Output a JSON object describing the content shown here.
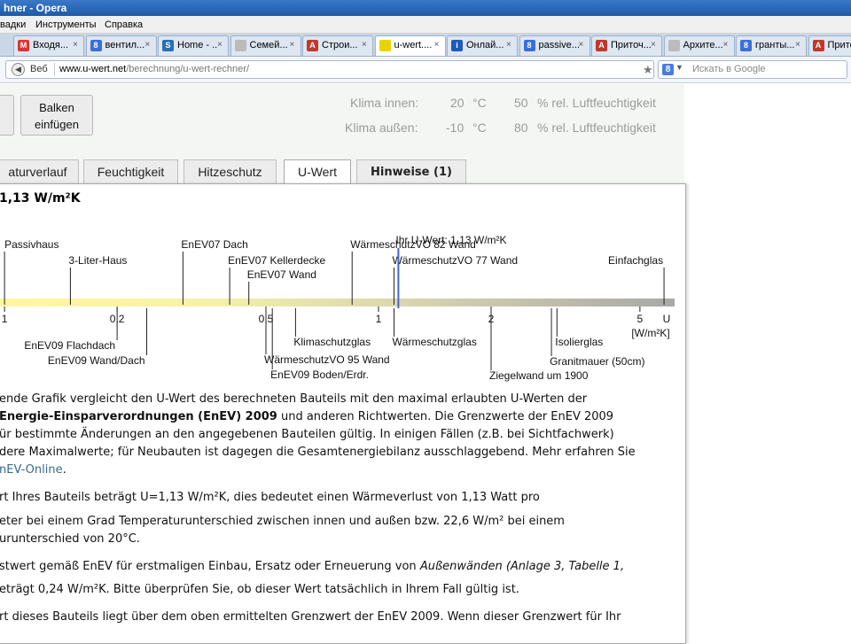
{
  "browser": {
    "title": "hner - Opera",
    "menu": [
      "вадки",
      "Инструменты",
      "Справка"
    ],
    "tabs": [
      {
        "label": "Входя...",
        "fav": "M",
        "color": "#d33"
      },
      {
        "label": "вентил...",
        "fav": "8",
        "color": "#3b6fd6"
      },
      {
        "label": "Home - ...",
        "fav": "S",
        "color": "#2a6fb0"
      },
      {
        "label": "Семей...",
        "fav": "",
        "color": "#bbbbbb"
      },
      {
        "label": "Строи...",
        "fav": "A",
        "color": "#c0392b"
      },
      {
        "label": "u-wert....",
        "fav": "",
        "color": "#e8d400"
      },
      {
        "label": "Онлай...",
        "fav": "i",
        "color": "#1f5ab8"
      },
      {
        "label": "passive...",
        "fav": "8",
        "color": "#3b6fd6"
      },
      {
        "label": "Приточ...",
        "fav": "A",
        "color": "#c0392b"
      },
      {
        "label": "Архите...",
        "fav": "",
        "color": "#bbbbbb"
      },
      {
        "label": "гранты...",
        "fav": "8",
        "color": "#3b6fd6"
      },
      {
        "label": "Приточ...",
        "fav": "A",
        "color": "#c0392b"
      }
    ],
    "active_tab": 5,
    "web_label": "Веб",
    "url_domain": "www.u-wert.net",
    "url_path": "/berechnung/u-wert-rechner/",
    "search_placeholder": "Искать в Google"
  },
  "page": {
    "balken_button": "Balken einfügen",
    "climate": {
      "inside_label": "Klima innen:",
      "inside_temp": "20",
      "inside_humidity": "50",
      "outside_label": "Klima außen:",
      "outside_temp": "-10",
      "outside_humidity": "80",
      "temp_unit": "°C",
      "humidity_unit": "% rel. Luftfeuchtigkeit"
    },
    "tabs": [
      "aturverlauf",
      "Feuchtigkeit",
      "Hitzeschutz",
      "U-Wert",
      "Hinweise (1)"
    ],
    "active_tab": 3,
    "heading": "1,13 W/m²K",
    "paragraphs": {
      "p1_l1": "ende Grafik vergleicht den U-Wert des berechneten Bauteils mit den maximal erlaubten U-Werten der",
      "p1_l2_bold": " Energie-Einsparverordnungen (EnEV) 2009",
      "p1_l2_rest": " und anderen Richtwerten. Die Grenzwerte der EnEV 2009",
      "p1_l3": "ür bestimmte Änderungen an den angegebenen Bauteilen gültig. In einigen Fällen (z.B. bei Sichtfachwerk)",
      "p1_l4": "dere Maximalwerte; für Neubauten ist dagegen die Gesamtenergiebilanz ausschlaggebend. Mehr erfahren Sie",
      "p1_l5_link": "nEV-Online",
      "p1_l5_rest": ".",
      "p2_l1": "rt Ihres Bauteils beträgt U=1,13 W/m²K, dies bedeutet einen Wärmeverlust von 1,13 Watt pro",
      "p2_l2": "eter bei einem Grad Temperaturunterschied zwischen innen und außen bzw. 22,6 W/m² bei einem",
      "p2_l3": "urunterschied von 20°C.",
      "p3_l1_a": "stwert gemäß EnEV für erstmaligen Einbau, Ersatz oder Erneuerung von ",
      "p3_l1_i": "Außenwänden (Anlage 3, Tabelle 1,",
      "p3_l2": "eträgt 0,24 W/m²K. Bitte überprüfen Sie, ob dieser Wert tatsächlich in Ihrem Fall gültig ist.",
      "p4_l1": "rt dieses Bauteils liegt über dem oben ermittelten Grenzwert der EnEV 2009. Wenn dieser Grenzwert für Ihr"
    }
  },
  "chart_data": {
    "type": "scatter",
    "axis": "log",
    "xlim": [
      0.1,
      6
    ],
    "tick_labels": [
      "1",
      "0,2",
      "0,5",
      "1",
      "2",
      "5"
    ],
    "tick_values": [
      0.1,
      0.2,
      0.5,
      1,
      2,
      5
    ],
    "unit_label_1": "U",
    "unit_label_2": "[W/m²K]",
    "marker_label": "Ihr U-Wert: 1,13 W/m²K",
    "marker_value": 1.13,
    "marker_color": "#4466cc",
    "references_above": [
      {
        "label": "Passivhaus",
        "value": 0.1
      },
      {
        "label": "3-Liter-Haus",
        "value": 0.15
      },
      {
        "label": "EnEV07 Dach",
        "value": 0.3
      },
      {
        "label": "EnEV07 Kellerdecke",
        "value": 0.4
      },
      {
        "label": "EnEV07 Wand",
        "value": 0.45
      },
      {
        "label": "WärmeschutzVO 82 Wand",
        "value": 0.85
      },
      {
        "label": "WärmeschutzVO 77 Wand",
        "value": 1.1
      },
      {
        "label": "Einfachglas",
        "value": 5.8
      }
    ],
    "references_below": [
      {
        "label": "EnEV09 Flachdach",
        "value": 0.2
      },
      {
        "label": "EnEV09 Wand/Dach",
        "value": 0.24
      },
      {
        "label": "Klimaschutzglas",
        "value": 0.6
      },
      {
        "label": "WärmeschutzVO 95 Wand",
        "value": 0.5
      },
      {
        "label": "EnEV09 Boden/Erdr.",
        "value": 0.52
      },
      {
        "label": "Wärmeschutzglas",
        "value": 1.1
      },
      {
        "label": "Ziegelwand um 1900",
        "value": 2.0
      },
      {
        "label": "Isolierglas",
        "value": 3.0
      },
      {
        "label": "Granitmauer (50cm)",
        "value": 2.9
      }
    ]
  }
}
